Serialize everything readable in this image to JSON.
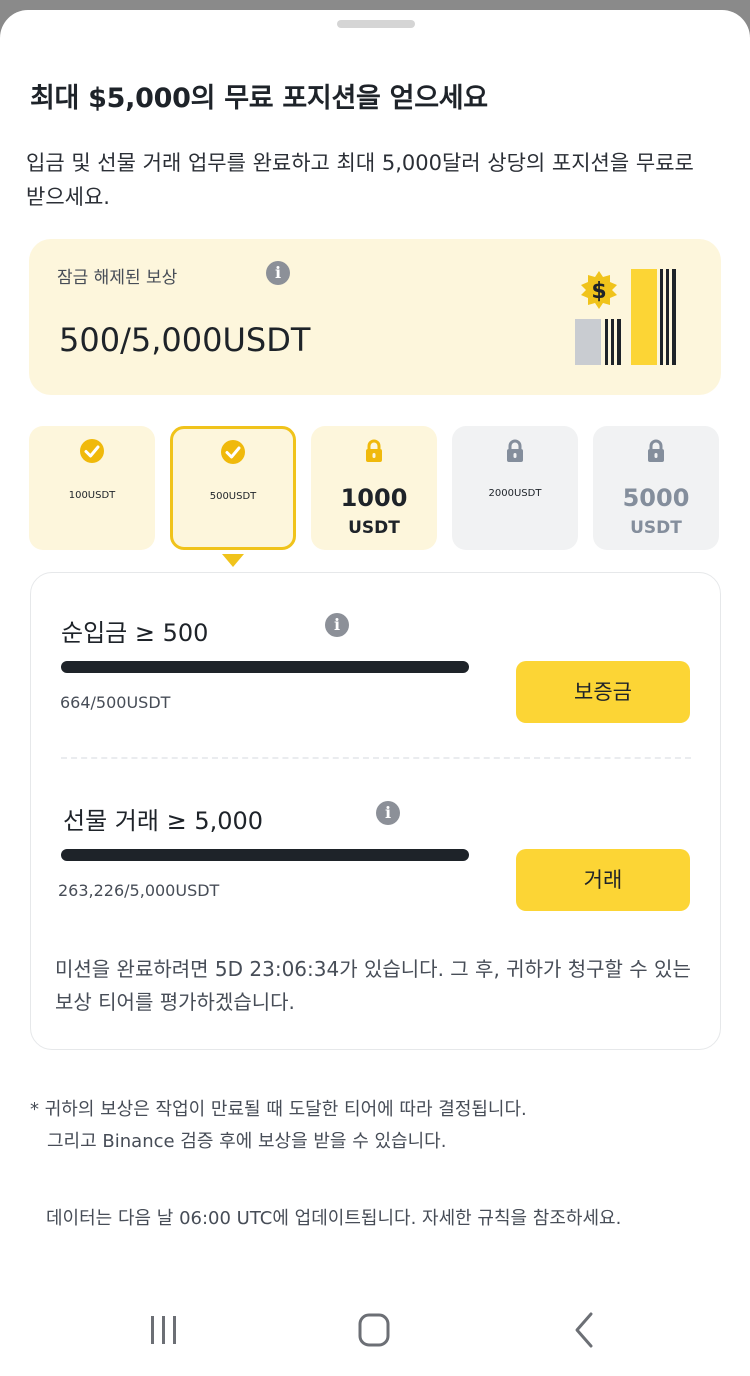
{
  "title": "최대 $5,000의 무료 포지션을 얻으세요",
  "description": "입금 및 선물 거래 업무를 완료하고 최대 5,000달러 상당의 포지션을 무료로 받으세요.",
  "reward": {
    "label": "잠금 해제된 보상",
    "value": "500/5,000USDT",
    "info_icon": "info-icon"
  },
  "tiers": [
    {
      "label": "100USDT",
      "status": "completed",
      "icon": "check-circle-icon"
    },
    {
      "label": "500USDT",
      "status": "completed",
      "icon": "check-circle-icon",
      "selected": true
    },
    {
      "amount": "1000",
      "unit": "USDT",
      "status": "next",
      "icon": "lock-icon"
    },
    {
      "label": "2000USDT",
      "status": "locked",
      "icon": "lock-icon"
    },
    {
      "amount": "5000",
      "unit": "USDT",
      "status": "locked",
      "icon": "lock-icon"
    }
  ],
  "missions": [
    {
      "title": "순입금 ≥ 500",
      "progress": "664/500USDT",
      "progress_fraction": 1.0,
      "button": "보증금"
    },
    {
      "title": "선물 거래 ≥ 5,000",
      "progress": "263,226/5,000USDT",
      "progress_fraction": 1.0,
      "button": "거래"
    }
  ],
  "mission_note": "미션을 완료하려면 5D 23:06:34가 있습니다. 그 후, 귀하가 청구할 수 있는 보상 티어를 평가하겠습니다.",
  "footnote": {
    "line1": "* 귀하의 보상은 작업이 만료될 때 도달한 티어에 따라 결정됩니다.",
    "line2": "그리고 Binance 검증 후에 보상을 받을 수 있습니다."
  },
  "data_note": "데이터는 다음 날 06:00 UTC에 업데이트됩니다. 자세한 규칙을 참조하세요.",
  "colors": {
    "accent": "#fcd535",
    "selected_border": "#f0c31b",
    "card_bg": "#fdf6dc",
    "locked_bg": "#f1f2f3",
    "text": "#1e2329"
  },
  "navbar": [
    "recent-apps-icon",
    "home-icon",
    "back-icon"
  ]
}
